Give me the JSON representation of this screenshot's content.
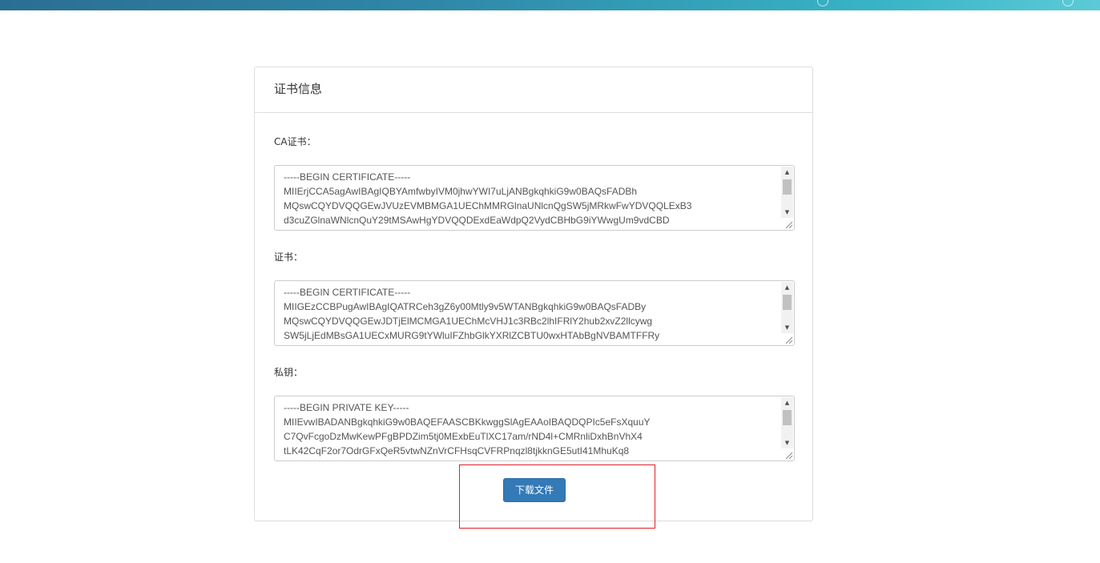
{
  "panel": {
    "title": "证书信息"
  },
  "fields": [
    {
      "label": "CA证书：",
      "content": "-----BEGIN CERTIFICATE-----\nMIIErjCCA5agAwIBAgIQBYAmfwbyIVM0jhwYWI7uLjANBgkqhkiG9w0BAQsFADBh\nMQswCQYDVQQGEwJVUzEVMBMGA1UEChMMRGlnaUNlcnQgSW5jMRkwFwYDVQQLExB3\nd3cuZGlnaWNlcnQuY29tMSAwHgYDVQQDExdEaWdpQ2VydCBHbG9iYWwgUm9vdCBD"
    },
    {
      "label": "证书：",
      "content": "-----BEGIN CERTIFICATE-----\nMIIGEzCCBPugAwIBAgIQATRCeh3gZ6y00Mtly9v5WTANBgkqhkiG9w0BAQsFADBy\nMQswCQYDVQQGEwJDTjElMCMGA1UEChMcVHJ1c3RBc2lhIFRlY2hub2xvZ2llcywg\nSW5jLjEdMBsGA1UECxMURG9tYWluIFZhbGlkYXRlZCBTU0wxHTAbBgNVBAMTFFRy"
    },
    {
      "label": "私钥：",
      "content": "-----BEGIN PRIVATE KEY-----\nMIIEvwIBADANBgkqhkiG9w0BAQEFAASCBKkwggSlAgEAAoIBAQDQPIc5eFsXquuY\nC7QvFcgoDzMwKewPFgBPDZim5tj0MExbEuTlXC17am/rND4l+CMRnliDxhBnVhX4\ntLK42CqF2or7OdrGFxQeR5vtwNZnVrCFHsqCVFRPnqzl8tjkknGE5utI41MhuKq8"
    }
  ],
  "actions": {
    "download_label": "下载文件"
  },
  "icons": {
    "scroll_up": "scroll-up-arrow-icon",
    "scroll_down": "scroll-down-arrow-icon",
    "resize": "resize-grip-icon"
  },
  "colors": {
    "primary_button": "#337ab7",
    "highlight": "#e0202a",
    "banner_start": "#2b6e93",
    "banner_end": "#5ccad6"
  }
}
